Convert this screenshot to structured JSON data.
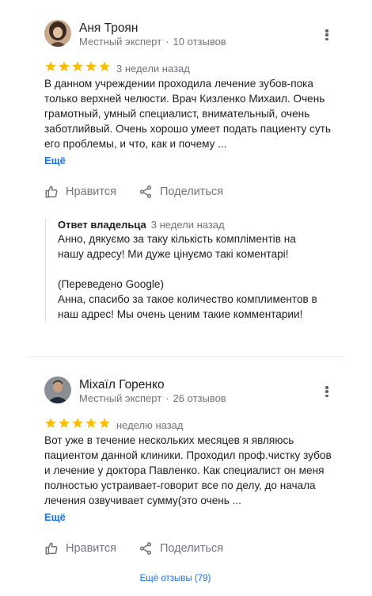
{
  "reviews": [
    {
      "author": "Аня Троян",
      "badge": "Местный эксперт",
      "review_count": "10 отзывов",
      "stars": 5,
      "time": "3 недели назад",
      "text": "В данном учреждении проходила лечение зубов-пока только верхней челюсти. Врач Кизленко Михаил. Очень грамотный, умный специалист, внимательный, очень заботлийвый. Очень хорошо умеет подать пациенту суть его проблемы, и что, как и почему ...",
      "more": "Ещё",
      "like": "Нравится",
      "share": "Поделиться",
      "owner_reply": {
        "label": "Ответ владельца",
        "time": "3 недели назад",
        "original": "Анно, дякуємо за таку кількість компліментів на нашу адресу! Ми дуже цінуємо такі коментарі!",
        "translated_note": "(Переведено Google)",
        "translated": "Анна, спасибо за такое количество комплиментов в наш адрес! Мы очень ценим такие комментарии!"
      }
    },
    {
      "author": "Міхаїл Горенко",
      "badge": "Местный эксперт",
      "review_count": "26 отзывов",
      "stars": 5,
      "time": "неделю назад",
      "text": "Вот уже в течение нескольких месяцев я являюсь пациентом данной клиники. Проходил проф.чистку зубов и лечение у доктора Павленко. Как специалист он меня полностью устраивает-говорит все по делу, до начала лечения озвучивает сумму(это очень ...",
      "more": "Ещё",
      "like": "Нравится",
      "share": "Поделиться"
    }
  ],
  "footer": {
    "all_reviews": "Ещё отзывы (79)"
  },
  "colors": {
    "star": "#fbbc04",
    "link": "#1a73e8",
    "secondary_text": "#70757a"
  },
  "icons": {
    "like": "thumbs-up-icon",
    "share": "share-icon",
    "menu": "more-vertical-icon"
  }
}
